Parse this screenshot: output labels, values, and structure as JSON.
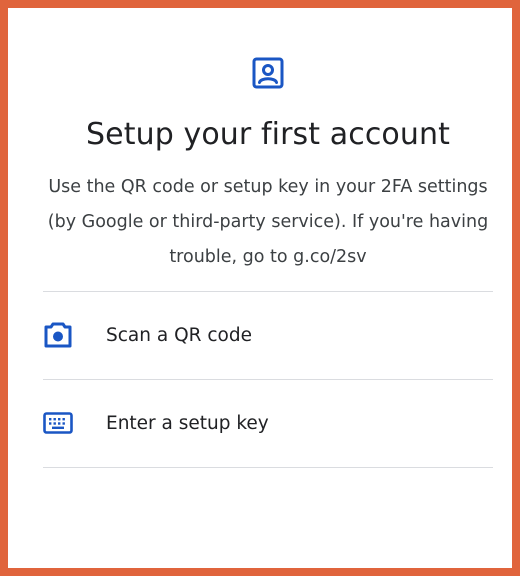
{
  "header": {
    "icon": "account-box-icon",
    "title": "Setup your first account",
    "description": "Use the QR code or setup key in your 2FA settings (by Google or third-party service). If you're having trouble, go to g.co/2sv"
  },
  "options": [
    {
      "icon": "camera-icon",
      "label": "Scan a QR code"
    },
    {
      "icon": "keyboard-icon",
      "label": "Enter a setup key"
    }
  ],
  "colors": {
    "accent": "#1a56c4",
    "border": "#e0643c",
    "divider": "#dadce0",
    "text": "#202124"
  }
}
